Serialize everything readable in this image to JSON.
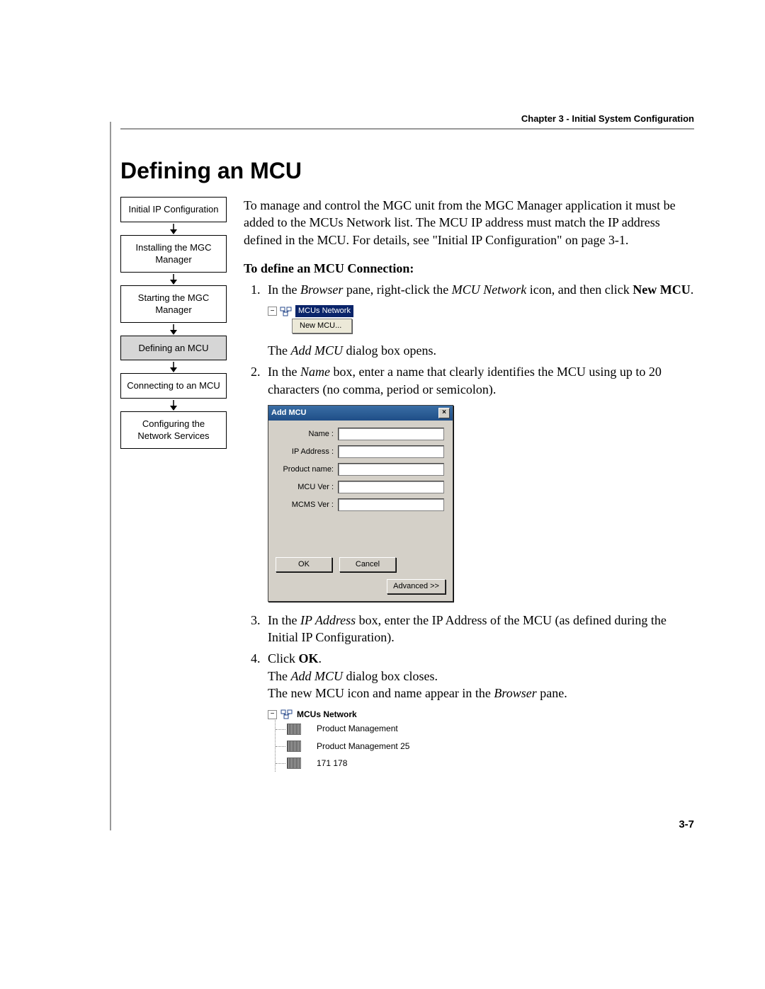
{
  "header": {
    "running": "Chapter 3 - Initial System Configuration"
  },
  "title": "Defining an MCU",
  "flow": {
    "steps": [
      "Initial IP Configuration",
      "Installing the MGC Manager",
      "Starting the MGC Manager",
      "Defining an MCU",
      "Connecting to an MCU",
      "Configuring the Network Services"
    ],
    "current_index": 3
  },
  "intro": {
    "p1a": "To manage and control the MGC unit from the MGC Manager application it must be added to the MCUs Network list. The MCU IP address must match the IP address defined in the MCU. For details, see \"Initial IP Configuration\" on page 3-1."
  },
  "subhead": "To define an MCU Connection:",
  "steps": {
    "s1": {
      "pre": "In the ",
      "i1": "Browser",
      "mid": " pane, right-click the ",
      "i2": "MCU Network",
      "post": " icon, and then click ",
      "bold": "New MCU",
      "end": "."
    },
    "ctx": {
      "root": "MCUs Network",
      "item": "New MCU..."
    },
    "after_ctx": {
      "pre": "The ",
      "i": "Add MCU",
      "post": " dialog box opens."
    },
    "s2": {
      "pre": "In the ",
      "i": "Name",
      "post": " box, enter a name that clearly identifies the MCU using up to 20 characters (no comma, period or semicolon)."
    },
    "dialog": {
      "title": "Add MCU",
      "labels": {
        "name": "Name :",
        "ip": "IP Address :",
        "product": "Product name:",
        "mcuver": "MCU Ver :",
        "mcmsver": "MCMS Ver :"
      },
      "buttons": {
        "ok": "OK",
        "cancel": "Cancel",
        "adv": "Advanced >>"
      }
    },
    "s3": {
      "pre": "In the ",
      "i": "IP Address",
      "post": " box, enter the IP Address of the MCU (as defined during the Initial IP Configuration)."
    },
    "s4": {
      "pre": "Click ",
      "b": "OK",
      "post": ".",
      "line2": {
        "pre": "The ",
        "i": "Add MCU",
        "post": " dialog box closes."
      },
      "line3": {
        "pre": "The new MCU icon and name appear in the ",
        "i": "Browser",
        "post": " pane."
      }
    },
    "tree": {
      "root": "MCUs Network",
      "items": [
        "Product Management",
        "Product Management 25",
        "171 178"
      ]
    }
  },
  "page_number": "3-7"
}
